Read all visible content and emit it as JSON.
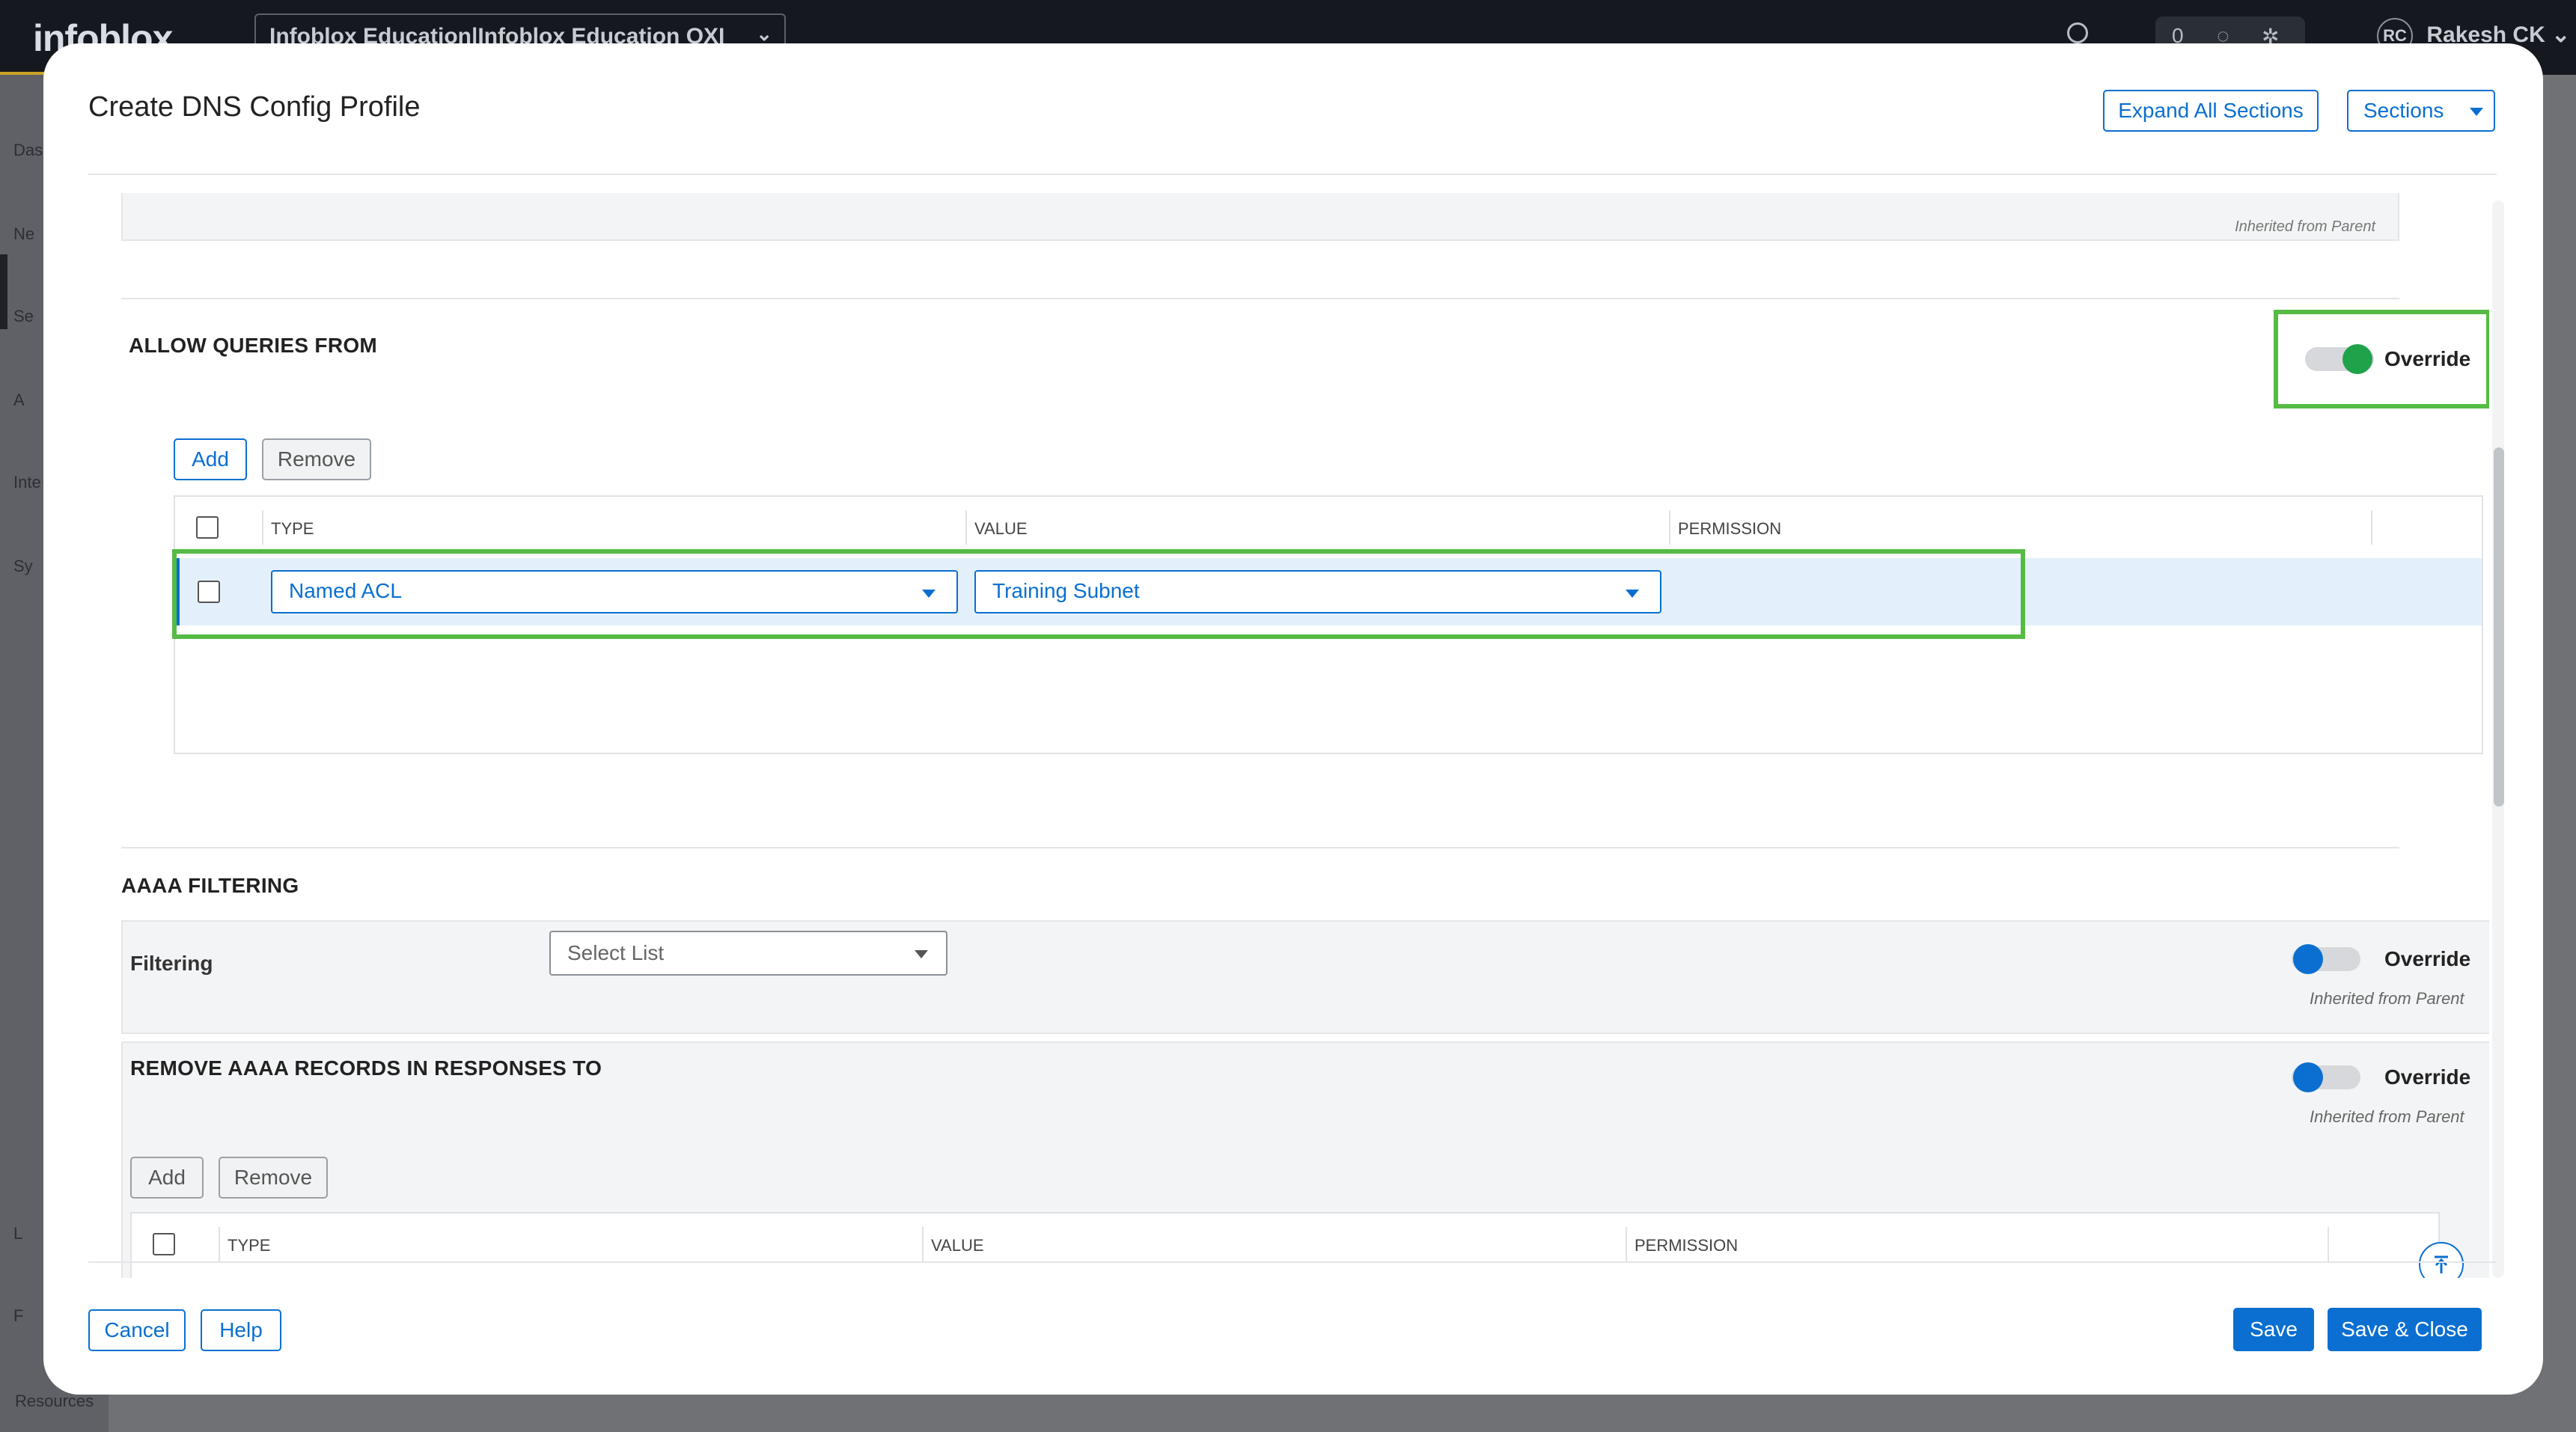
{
  "background_app": {
    "brand": "infoblox",
    "org_selector": "Infoblox Education|Infoblox Education OXI",
    "notification_count": "0",
    "user": {
      "initials": "RC",
      "name": "Rakesh CK"
    },
    "nav_fragments": [
      "Das",
      "Ne",
      "Se",
      "A",
      "Inte",
      "Sy",
      "L",
      "F"
    ],
    "footer_link": "Resources"
  },
  "modal": {
    "title": "Create DNS Config Profile",
    "header_buttons": {
      "expand_all": "Expand All Sections",
      "sections": "Sections"
    },
    "previous_section": {
      "inherited_text": "Inherited from Parent"
    },
    "allow_queries_from": {
      "title": "ALLOW QUERIES FROM",
      "override": {
        "label": "Override",
        "enabled": true
      },
      "actions": {
        "add": "Add",
        "remove": "Remove"
      },
      "columns": {
        "type": "TYPE",
        "value": "VALUE",
        "permission": "PERMISSION"
      },
      "rows": [
        {
          "type": "Named ACL",
          "value": "Training Subnet",
          "permission": "",
          "selected": false
        }
      ]
    },
    "aaaa_filtering": {
      "title": "AAAA FILTERING",
      "filtering": {
        "label": "Filtering",
        "placeholder": "Select List",
        "override": {
          "label": "Override",
          "enabled": false
        },
        "inherited_text": "Inherited from Parent"
      },
      "remove_records": {
        "title": "REMOVE AAAA RECORDS IN RESPONSES TO",
        "override": {
          "label": "Override",
          "enabled": false
        },
        "inherited_text": "Inherited from Parent",
        "actions": {
          "add": "Add",
          "remove": "Remove"
        },
        "columns": {
          "type": "TYPE",
          "value": "VALUE",
          "permission": "PERMISSION"
        }
      }
    },
    "footer_buttons": {
      "cancel": "Cancel",
      "help": "Help",
      "save": "Save",
      "save_close": "Save & Close"
    },
    "colors": {
      "accent": "#0a6fd0",
      "toggle_on": "#1fa34a",
      "highlight": "#55bb44"
    }
  }
}
